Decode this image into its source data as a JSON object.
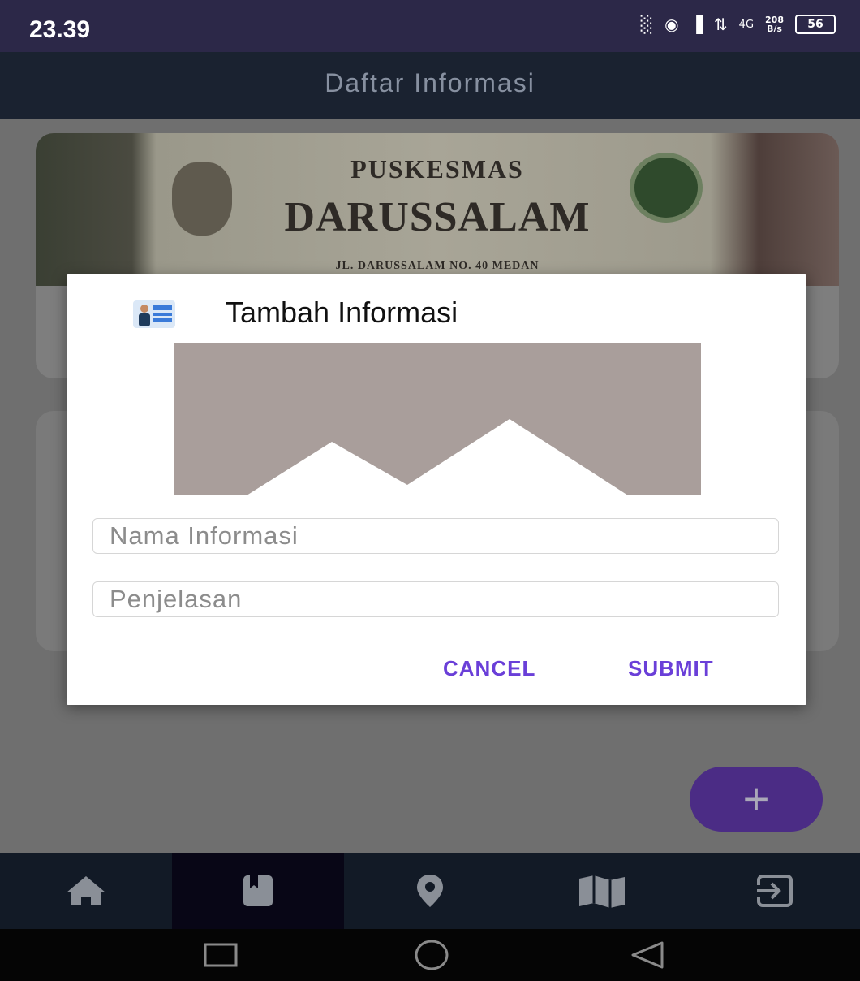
{
  "status_bar": {
    "time": "23.39",
    "network": "4G",
    "speed_value": "208",
    "speed_unit": "B/s",
    "battery": "56"
  },
  "app_bar": {
    "title": "Daftar Informasi"
  },
  "cards": [
    {
      "photo_sign": {
        "line1": "PUSKESMAS",
        "line2": "DARUSSALAM",
        "line3": "JL. DARUSSALAM NO. 40 MEDAN"
      }
    }
  ],
  "dialog": {
    "title": "Tambah Informasi",
    "name_field": {
      "placeholder": "Nama Informasi",
      "value": ""
    },
    "description_field": {
      "placeholder": "Penjelasan",
      "value": ""
    },
    "cancel_label": "CANCEL",
    "submit_label": "SUBMIT"
  },
  "fab": {
    "label": "+"
  },
  "bottom_nav": {
    "items": [
      {
        "icon": "home-icon"
      },
      {
        "icon": "bookmark-icon",
        "active": true
      },
      {
        "icon": "location-pin-icon"
      },
      {
        "icon": "map-icon"
      },
      {
        "icon": "logout-icon"
      }
    ]
  },
  "system_nav": {
    "buttons": [
      "recents-icon",
      "home-circle-icon",
      "back-icon"
    ]
  },
  "colors": {
    "accent": "#6a3fd8",
    "fab": "#4b2c85",
    "app_bar": "#1a2230",
    "status_bar": "#2c2848",
    "nav_bar": "#121a26",
    "placeholder_image": "#a99e9b"
  }
}
